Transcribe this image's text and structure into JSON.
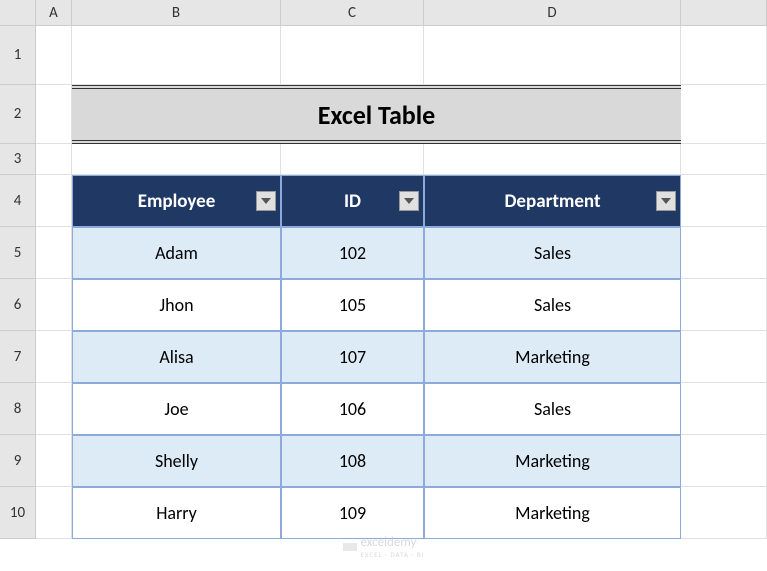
{
  "columns": [
    "A",
    "B",
    "C",
    "D"
  ],
  "rows": [
    "1",
    "2",
    "3",
    "4",
    "5",
    "6",
    "7",
    "8",
    "9",
    "10"
  ],
  "title": "Excel Table",
  "table": {
    "headers": [
      "Employee",
      "ID",
      "Department"
    ],
    "rows": [
      {
        "employee": "Adam",
        "id": "102",
        "department": "Sales"
      },
      {
        "employee": "Jhon",
        "id": "105",
        "department": "Sales"
      },
      {
        "employee": "Alisa",
        "id": "107",
        "department": "Marketing"
      },
      {
        "employee": "Joe",
        "id": "106",
        "department": "Sales"
      },
      {
        "employee": "Shelly",
        "id": "108",
        "department": "Marketing"
      },
      {
        "employee": "Harry",
        "id": "109",
        "department": "Marketing"
      }
    ]
  },
  "watermark": {
    "name": "exceldemy",
    "tagline": "EXCEL · DATA · BI"
  }
}
